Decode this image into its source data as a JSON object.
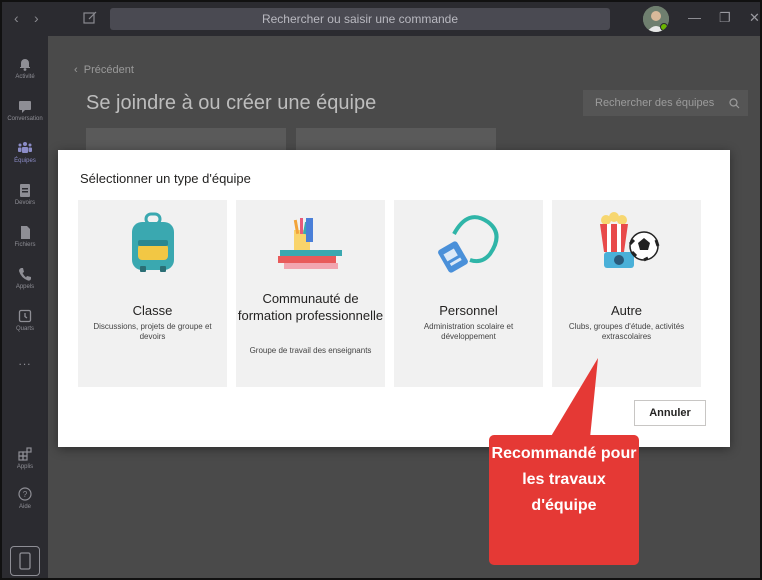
{
  "titlebar": {
    "search_placeholder": "Rechercher ou saisir une commande"
  },
  "rail": {
    "items": [
      {
        "label": "Activité",
        "icon": "bell-icon"
      },
      {
        "label": "Conversation",
        "icon": "chat-icon"
      },
      {
        "label": "Équipes",
        "icon": "teams-icon"
      },
      {
        "label": "Devoirs",
        "icon": "assignments-icon"
      },
      {
        "label": "Fichiers",
        "icon": "files-icon"
      },
      {
        "label": "Appels",
        "icon": "phone-icon"
      },
      {
        "label": "Quarts",
        "icon": "shifts-icon"
      },
      {
        "label": "Applis",
        "icon": "apps-icon"
      },
      {
        "label": "Aide",
        "icon": "help-icon"
      }
    ],
    "more": "...",
    "active": "Équipes"
  },
  "main": {
    "back_label": "Précédent",
    "title": "Se joindre à ou créer une équipe",
    "search_placeholder": "Rechercher des équipes"
  },
  "modal": {
    "title": "Sélectionner un type d'équipe",
    "tiles": [
      {
        "title": "Classe",
        "desc": "Discussions, projets de groupe et devoirs",
        "icon": "backpack-icon"
      },
      {
        "title": "Communauté de formation professionnelle",
        "desc": "Groupe de travail des enseignants",
        "icon": "books-pencils-icon"
      },
      {
        "title": "Personnel",
        "desc": "Administration scolaire et développement",
        "icon": "lanyard-badge-icon"
      },
      {
        "title": "Autre",
        "desc": "Clubs, groupes d'étude, activités extrascolaires",
        "icon": "popcorn-soccer-icon"
      }
    ],
    "cancel_label": "Annuler"
  },
  "callout": {
    "text": "Recommandé pour les travaux d'équipe",
    "color": "#e53935"
  },
  "colors": {
    "rail_bg": "#2b2b30",
    "accent": "#8b8cc7",
    "dim_bg": "#4a4a4a"
  }
}
